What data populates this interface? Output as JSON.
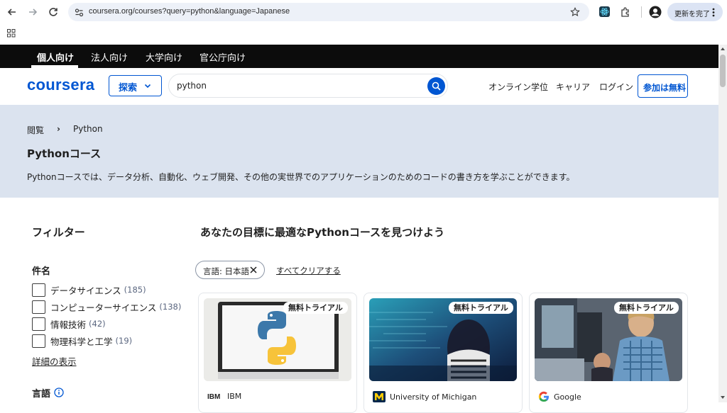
{
  "browser": {
    "url": "coursera.org/courses?query=python&language=Japanese",
    "update_label": "更新を完了"
  },
  "audience_tabs": [
    "個人向け",
    "法人向け",
    "大学向け",
    "官公庁向け"
  ],
  "header": {
    "logo": "coursera",
    "explore_label": "探索",
    "search_value": "python",
    "links": [
      "オンライン学位",
      "キャリア",
      "ログイン"
    ],
    "join_label": "参加は無料"
  },
  "hero": {
    "breadcrumb": [
      "閲覧",
      "Python"
    ],
    "breadcrumb_sep": "›",
    "title": "Pythonコース",
    "description": "Pythonコースでは、データ分析、自動化、ウェブ開発、その他の実世界でのアプリケーションのためのコードの書き方を学ぶことができます。"
  },
  "filters": {
    "title": "フィルター",
    "subject_heading": "件名",
    "subjects": [
      {
        "label": "データサイエンス",
        "count": "(185)"
      },
      {
        "label": "コンピューターサイエンス",
        "count": "(138)"
      },
      {
        "label": "情報技術",
        "count": "(42)"
      },
      {
        "label": "物理科学と工学",
        "count": "(19)"
      }
    ],
    "show_more": "詳細の表示",
    "language_heading": "言語"
  },
  "results": {
    "title": "あなたの目標に最適なPythonコースを見つけよう",
    "active_filter": "言語: 日本語",
    "clear_all": "すべてクリアする",
    "cards": [
      {
        "badge": "無料トライアル",
        "partner": "IBM"
      },
      {
        "badge": "無料トライアル",
        "partner": "University of Michigan"
      },
      {
        "badge": "無料トライアル",
        "partner": "Google"
      }
    ]
  },
  "colors": {
    "brand": "#0056d2",
    "hero_bg": "#dbe3ef",
    "tabbar_bg": "#0c0c0c"
  }
}
